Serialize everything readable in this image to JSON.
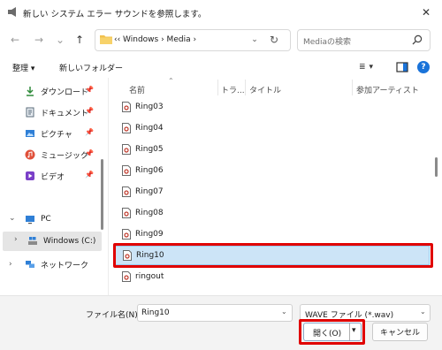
{
  "window": {
    "title": "新しい システム エラー サウンドを参照します。",
    "close_glyph": "✕"
  },
  "nav": {
    "back_glyph": "←",
    "forward_glyph": "→",
    "recent_glyph": "⌄",
    "up_glyph": "↑",
    "address_path": "‹‹  Windows  ›  Media  ›",
    "address_dropdown_glyph": "⌄",
    "refresh_glyph": "↻",
    "search_placeholder": "Mediaの検索"
  },
  "commandbar": {
    "organize_label": "整理 ▾",
    "new_folder_label": "新しいフォルダー",
    "view_glyph": "≣",
    "view_dropdown_glyph": "▾",
    "help_glyph": "?"
  },
  "navpane": {
    "items": [
      {
        "label": "ダウンロード",
        "icon": "download-icon",
        "icon_color": "#2f8a3a",
        "pinned": true
      },
      {
        "label": "ドキュメント",
        "icon": "document-icon",
        "icon_color": "#5a6b7a",
        "pinned": true
      },
      {
        "label": "ピクチャ",
        "icon": "picture-icon",
        "icon_color": "#2f7fd6",
        "pinned": true
      },
      {
        "label": "ミュージック",
        "icon": "music-icon",
        "icon_color": "#e0503a",
        "pinned": true
      },
      {
        "label": "ビデオ",
        "icon": "video-icon",
        "icon_color": "#7a3fc8",
        "pinned": true
      },
      {
        "label": "PC",
        "icon": "pc-icon",
        "icon_color": "#2f7fd6",
        "expanded": true
      },
      {
        "label": "Windows (C:)",
        "icon": "drive-icon",
        "icon_color": "#2f7fd6",
        "selected": true
      },
      {
        "label": "ネットワーク",
        "icon": "network-icon",
        "icon_color": "#2f7fd6"
      }
    ],
    "pin_glyph": "📌",
    "expand_open_glyph": "⌄",
    "expand_closed_glyph": "›"
  },
  "filelist": {
    "columns": [
      "名前",
      "トラ...",
      "タイトル",
      "参加アーティスト"
    ],
    "sort_glyph": "⌃",
    "files": [
      "Ring03",
      "Ring04",
      "Ring05",
      "Ring06",
      "Ring07",
      "Ring08",
      "Ring09",
      "Ring10",
      "ringout"
    ],
    "selected_file": "Ring10"
  },
  "footer": {
    "filename_label": "ファイル名(N):",
    "filename_value": "Ring10",
    "filetype_value": "WAVE ファイル (*.wav)",
    "open_label": "開く(O)",
    "open_arrow_glyph": "▾",
    "cancel_label": "キャンセル",
    "highlight_color": "#e00000"
  }
}
